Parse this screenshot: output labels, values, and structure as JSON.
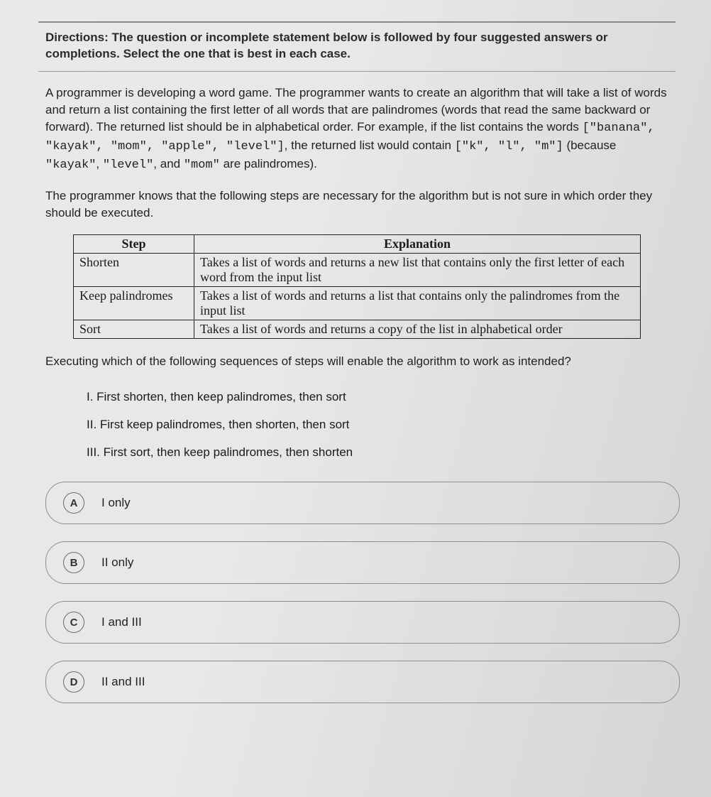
{
  "directions": "Directions: The question or incomplete statement below is followed by four suggested answers or completions. Select the one that is best in each case.",
  "p1": {
    "t1": "A programmer is developing a word game. The programmer wants to create an algorithm that will take a list of words and return a list containing the first letter of all words that are palindromes (words that read the same backward or forward). The returned list should be in alphabetical order. For example, if the list contains the words ",
    "code1": "[\"banana\", \"kayak\", \"mom\", \"apple\", \"level\"]",
    "t2": ", the returned list would contain ",
    "code2": "[\"k\", \"l\", \"m\"]",
    "t3": " (because ",
    "code3": "\"kayak\"",
    "t4": ", ",
    "code4": "\"level\"",
    "t5": ", and ",
    "code5": "\"mom\"",
    "t6": " are palindromes)."
  },
  "p2": "The programmer knows that the following steps are necessary for the algorithm but is not sure in which order they should be executed.",
  "table": {
    "h1": "Step",
    "h2": "Explanation",
    "rows": [
      {
        "step": "Shorten",
        "exp": "Takes a list of words and returns a new list that contains only the first letter of each word from the input list"
      },
      {
        "step": "Keep palindromes",
        "exp": "Takes a list of words and returns a list that contains only the palindromes from the input list"
      },
      {
        "step": "Sort",
        "exp": "Takes a list of words and returns a copy of the list in alphabetical order"
      }
    ]
  },
  "p3": "Executing which of the following sequences of steps will enable the algorithm to work as intended?",
  "seq": {
    "i": "I. First shorten, then keep palindromes, then sort",
    "ii": "II. First keep palindromes, then shorten, then sort",
    "iii": "III. First sort, then keep palindromes, then shorten"
  },
  "answers": [
    {
      "letter": "A",
      "text": "I only"
    },
    {
      "letter": "B",
      "text": "II only"
    },
    {
      "letter": "C",
      "text": "I and III"
    },
    {
      "letter": "D",
      "text": "II and III"
    }
  ]
}
